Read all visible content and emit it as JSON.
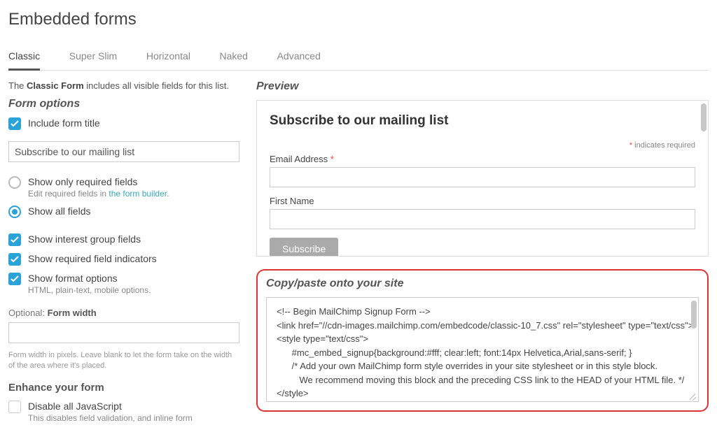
{
  "page_title": "Embedded forms",
  "tabs": [
    "Classic",
    "Super Slim",
    "Horizontal",
    "Naked",
    "Advanced"
  ],
  "active_tab": 0,
  "intro": {
    "prefix": "The ",
    "bold": "Classic Form",
    "suffix": " includes all visible fields for this list."
  },
  "form_options": {
    "heading": "Form options",
    "include_title": {
      "label": "Include form title",
      "checked": true,
      "value": "Subscribe to our mailing list"
    },
    "fields_radio": {
      "required_only": {
        "label": "Show only required fields",
        "sub_prefix": "Edit required fields in ",
        "sub_link": "the form builder",
        "sub_suffix": "."
      },
      "show_all": {
        "label": "Show all fields"
      },
      "selected": "show_all"
    },
    "checks": {
      "interest_groups": {
        "label": "Show interest group fields",
        "checked": true
      },
      "required_indicators": {
        "label": "Show required field indicators",
        "checked": true
      },
      "format_options": {
        "label": "Show format options",
        "sub": "HTML, plain-text, mobile options.",
        "checked": true
      }
    },
    "width": {
      "label_prefix": "Optional: ",
      "label_bold": "Form width",
      "value": "",
      "helper": "Form width in pixels. Leave blank to let the form take on the width of the area where it's placed."
    },
    "enhance": {
      "heading": "Enhance your form",
      "disable_js": {
        "label": "Disable all JavaScript",
        "sub": "This disables field validation, and inline form",
        "checked": false
      }
    }
  },
  "preview": {
    "heading": "Preview",
    "title": "Subscribe to our mailing list",
    "required_note": "indicates required",
    "email_label": "Email Address",
    "firstname_label": "First Name",
    "subscribe_btn": "Subscribe"
  },
  "code": {
    "heading": "Copy/paste onto your site",
    "text": "<!-- Begin MailChimp Signup Form -->\n<link href=\"//cdn-images.mailchimp.com/embedcode/classic-10_7.css\" rel=\"stylesheet\" type=\"text/css\">\n<style type=\"text/css\">\n      #mc_embed_signup{background:#fff; clear:left; font:14px Helvetica,Arial,sans-serif; }\n      /* Add your own MailChimp form style overrides in your site stylesheet or in this style block.\n         We recommend moving this block and the preceding CSS link to the HEAD of your HTML file. */\n</style>\n<div id=\"mc_embed_signup\">"
  }
}
